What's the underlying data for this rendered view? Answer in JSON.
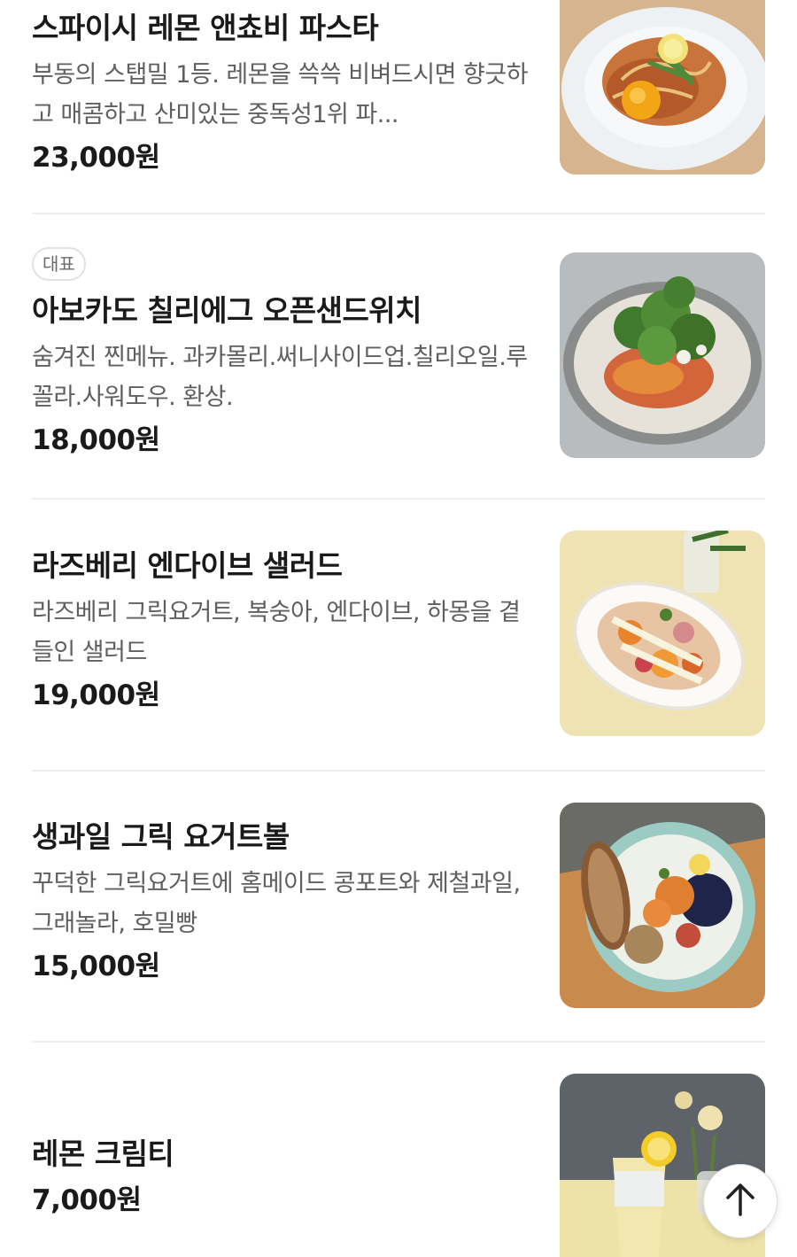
{
  "menu": {
    "items": [
      {
        "title": "스파이시 레몬 앤쵸비 파스타",
        "description": "부동의 스탭밀 1등. 레몬을 쓱쓱 비벼드시면 향긋하고 매콤하고 산미있는 중독성1위 파...",
        "price": "23,000원"
      },
      {
        "badge": "대표",
        "title": "아보카도 칠리에그 오픈샌드위치",
        "description": "숨겨진 찐메뉴. 과카몰리.써니사이드업.칠리오일.루꼴라.사워도우. 환상.",
        "price": "18,000원"
      },
      {
        "title": "라즈베리 엔다이브 샐러드",
        "description": "라즈베리 그릭요거트, 복숭아, 엔다이브, 하몽을 곁들인 샐러드",
        "price": "19,000원"
      },
      {
        "title": "생과일 그릭 요거트볼",
        "description": "꾸덕한 그릭요거트에 홈메이드 콩포트와 제철과일, 그래놀라, 호밀빵",
        "price": "15,000원"
      },
      {
        "title": "레몬 크림티",
        "price": "7,000원"
      }
    ]
  },
  "scroll_top_button": {
    "icon": "arrow-up-icon"
  }
}
